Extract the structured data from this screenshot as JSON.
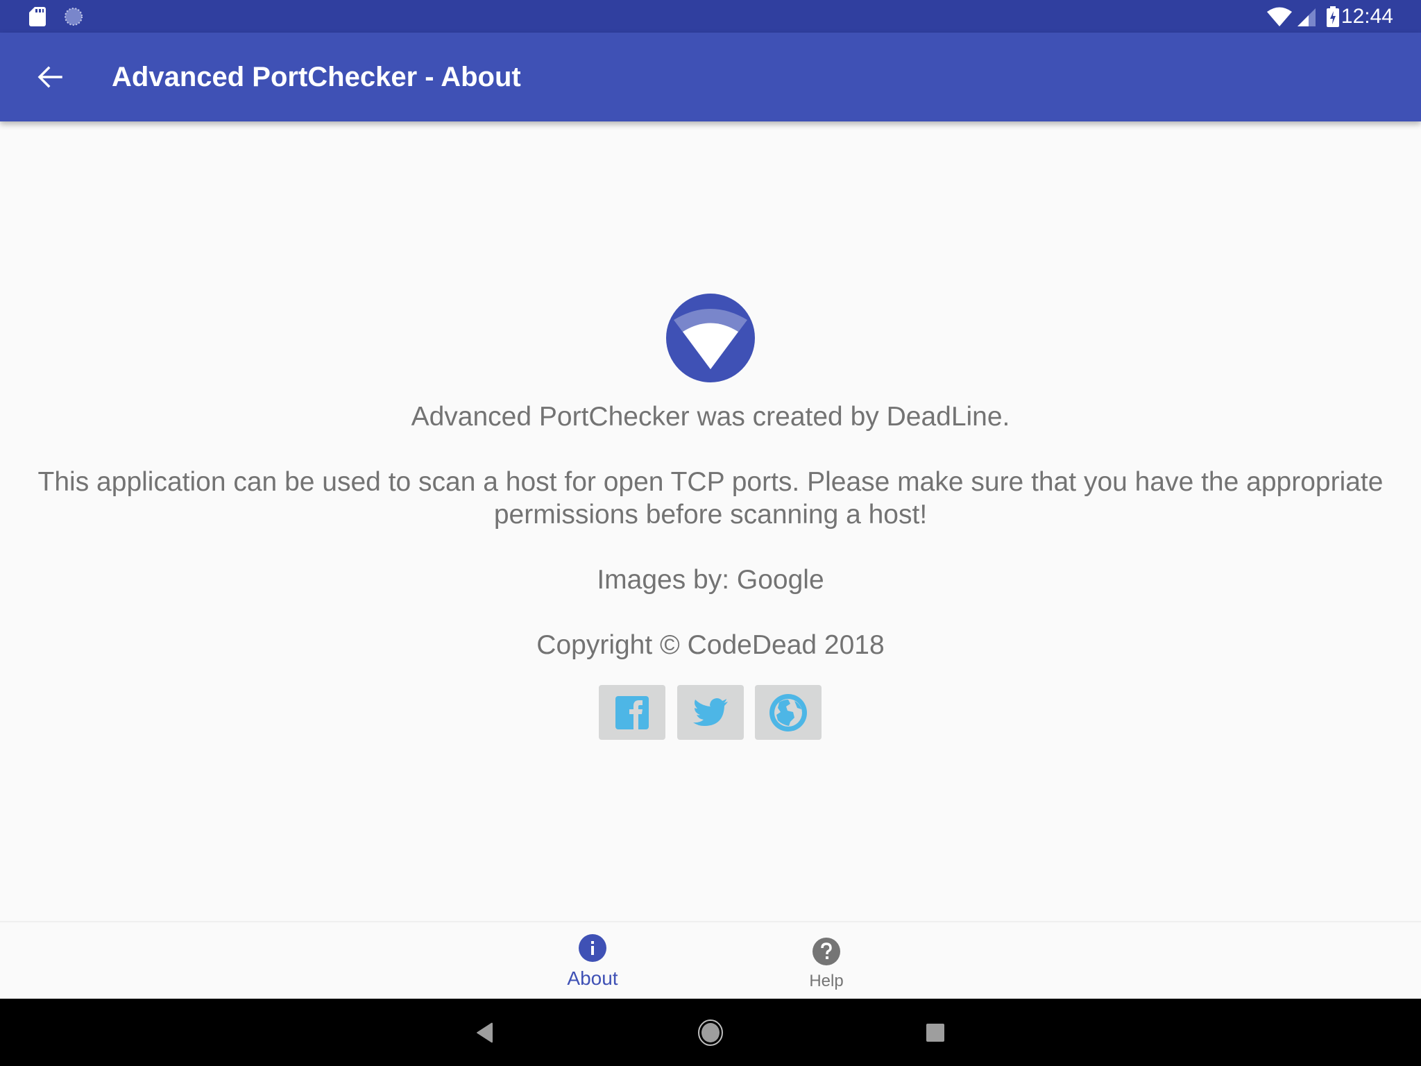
{
  "status_bar": {
    "time": "12:44",
    "left_icons": [
      "sd-card-icon",
      "sync-icon"
    ],
    "right_icons": [
      "wifi-icon",
      "cell-signal-icon",
      "battery-charging-icon"
    ]
  },
  "app_bar": {
    "back_icon": "arrow-back-icon",
    "title": "Advanced PortChecker - About"
  },
  "about": {
    "logo_icon": "app-logo-icon",
    "created_by": "Advanced PortChecker was created by DeadLine.",
    "description_line1": "This application can be used to scan a host for open TCP ports. Please make sure that you have the appropriate",
    "description_line2": "permissions before scanning a host!",
    "images_by": "Images by: Google",
    "copyright": "Copyright © CodeDead 2018",
    "social_buttons": [
      {
        "name": "facebook",
        "icon": "facebook-icon"
      },
      {
        "name": "twitter",
        "icon": "twitter-icon"
      },
      {
        "name": "website",
        "icon": "globe-icon"
      }
    ]
  },
  "bottom_nav": {
    "items": [
      {
        "label": "About",
        "icon": "info-icon",
        "active": true
      },
      {
        "label": "Help",
        "icon": "help-icon",
        "active": false
      }
    ]
  },
  "system_nav": {
    "buttons": [
      "back",
      "home",
      "recents"
    ]
  },
  "colors": {
    "primary": "#3f51b5",
    "primary_dark": "#303f9f",
    "accent_social": "#4db6e6",
    "text_secondary": "#737373",
    "inactive_icon": "#757575"
  }
}
